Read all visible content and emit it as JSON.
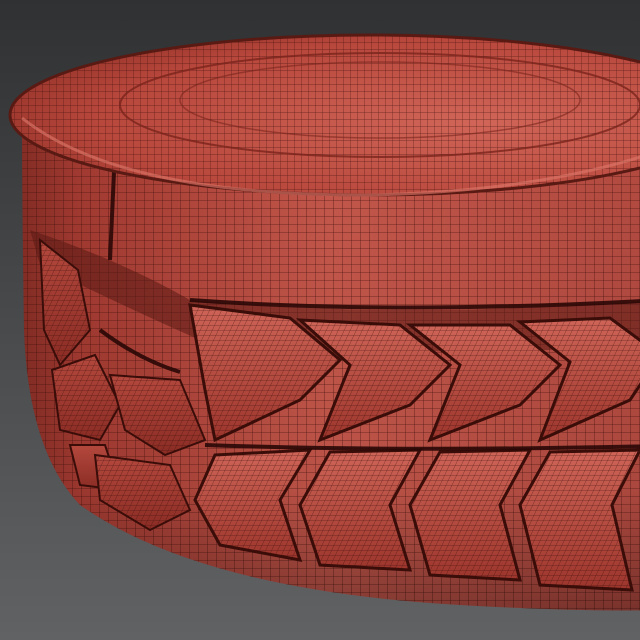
{
  "scene": {
    "subject": "tire-wireframe-render",
    "colors": {
      "background_top": "#2f3133",
      "background_bottom": "#5f6163",
      "mesh_base": "#b8463c",
      "mesh_light": "#d76a5d",
      "mesh_dark": "#6a1c16",
      "wire": "#3a0d09"
    }
  }
}
